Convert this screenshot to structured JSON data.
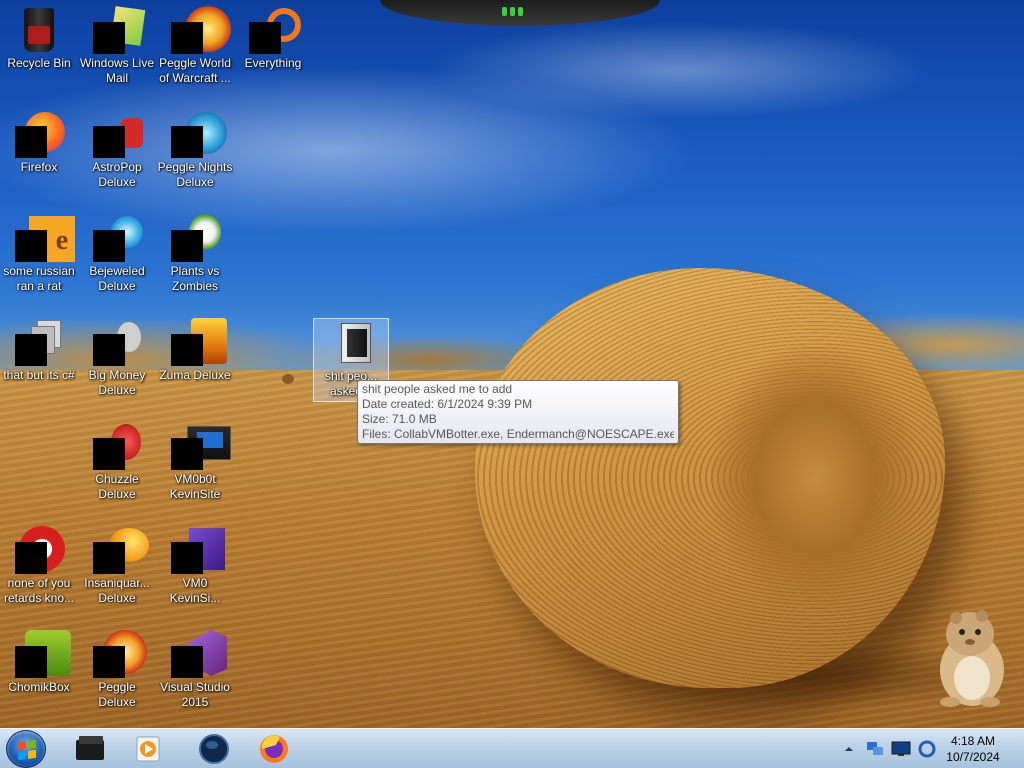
{
  "desktop": {
    "icons": [
      {
        "label": "Recycle Bin",
        "icon": "recycle-bin-icon"
      },
      {
        "label": "Windows Live\nMail",
        "icon": "mail-icon"
      },
      {
        "label": "Peggle World\nof Warcraft ...",
        "icon": "peggle-wow-icon"
      },
      {
        "label": "Everything",
        "icon": "everything-search-icon"
      },
      {
        "label": "Firefox",
        "icon": "firefox-icon"
      },
      {
        "label": "AstroPop\nDeluxe",
        "icon": "astropop-icon"
      },
      {
        "label": "Peggle Nights\nDeluxe",
        "icon": "peggle-nights-icon"
      },
      {
        "label": "some russian\nran a rat",
        "icon": "ie-icon"
      },
      {
        "label": "Bejeweled\nDeluxe",
        "icon": "bejeweled-icon"
      },
      {
        "label": "Plants vs\nZombies",
        "icon": "plants-vs-zombies-icon"
      },
      {
        "label": "that but its c#",
        "icon": "shortcut-icon"
      },
      {
        "label": "Big Money\nDeluxe",
        "icon": "big-money-icon"
      },
      {
        "label": "Zuma Deluxe",
        "icon": "zuma-icon"
      },
      {
        "label": "shit peo...\nasked...",
        "icon": "folder-icon"
      },
      {
        "label": "Chuzzle\nDeluxe",
        "icon": "chuzzle-icon"
      },
      {
        "label": "VM0b0t\nKevinSite",
        "icon": "vm0b0t-icon"
      },
      {
        "label": "none of you\nretards kno...",
        "icon": "opera-icon"
      },
      {
        "label": "Insaniquar...\nDeluxe",
        "icon": "insaniquarium-icon"
      },
      {
        "label": "VM0\nKevinSi...",
        "icon": "vm0-icon"
      },
      {
        "label": "ChomikBox",
        "icon": "chomikbox-icon"
      },
      {
        "label": "Peggle Deluxe",
        "icon": "peggle-icon"
      },
      {
        "label": "Visual Studio\n2015",
        "icon": "visual-studio-icon"
      }
    ]
  },
  "tooltip": {
    "title": "shit people asked me to add",
    "date_created": "Date created: 6/1/2024 9:39 PM",
    "size": "Size: 71.0 MB",
    "files": "Files: CollabVMBotter.exe, Endermanch@NOESCAPE.exe, ..."
  },
  "taskbar": {
    "start": "start-orb-icon",
    "pinned": [
      "terminal-icon",
      "media-player-icon",
      "globe-icon",
      "firefox-icon"
    ],
    "tray_icons": [
      "show-hidden-icons-chevron",
      "network-icon",
      "monitor-icon",
      "sync-icon"
    ],
    "time": "4:18 AM",
    "date": "10/7/2024"
  }
}
